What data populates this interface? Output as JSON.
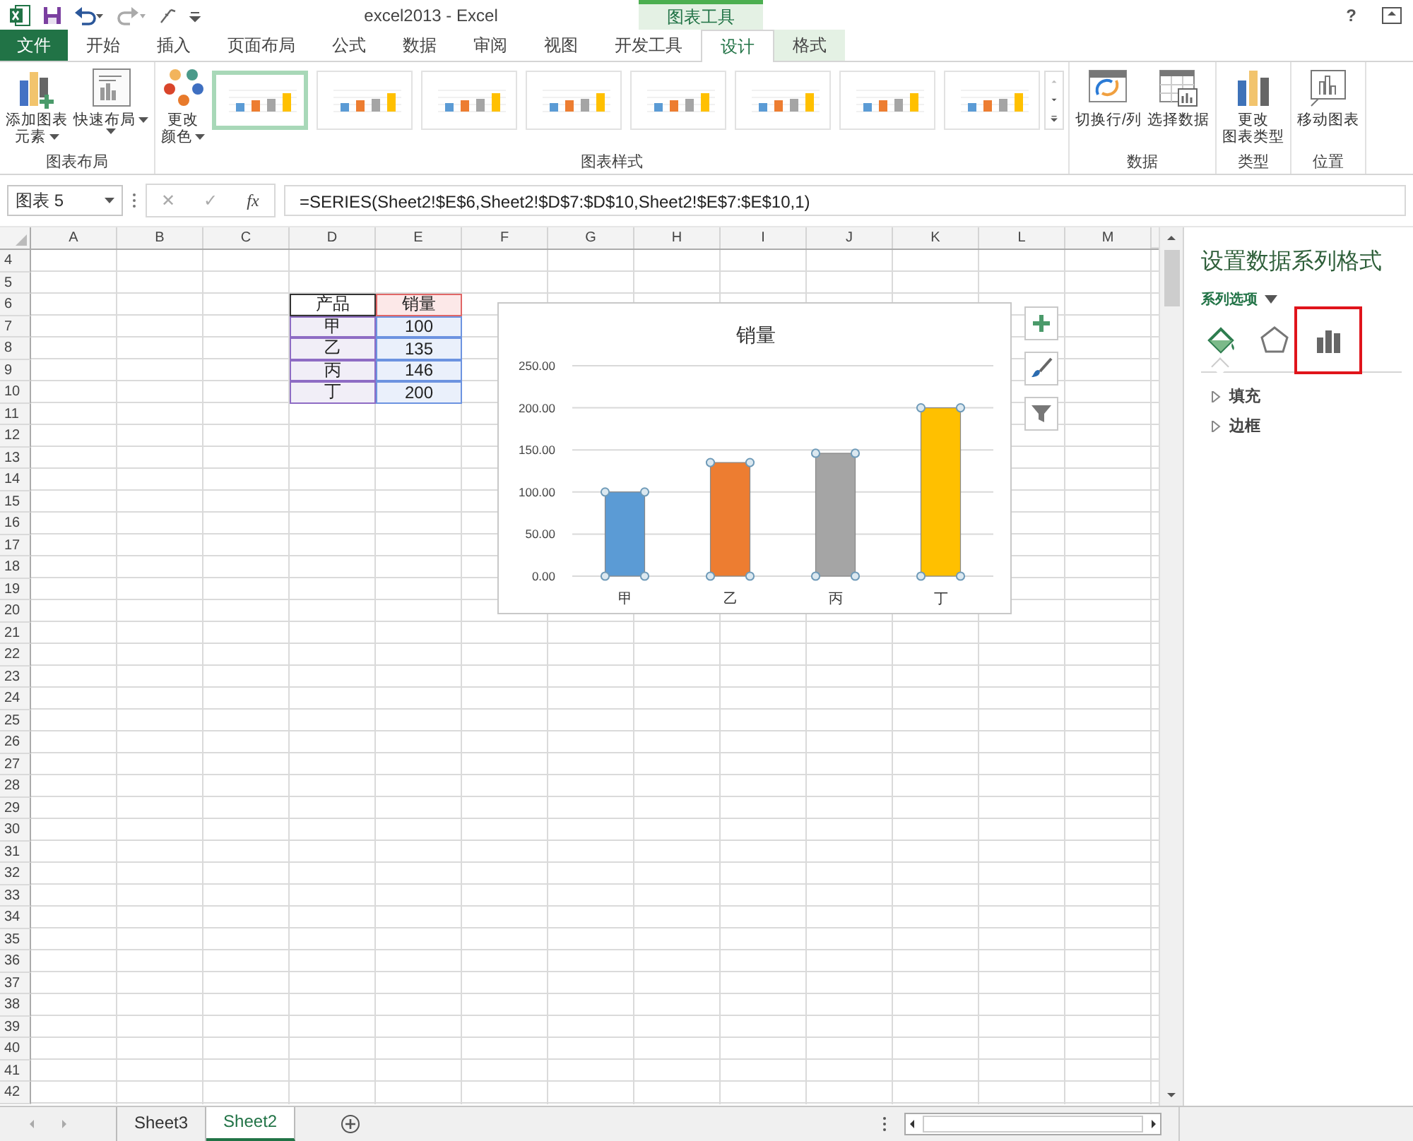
{
  "title_bar": {
    "title": "excel2013 - Excel",
    "context_label": "图表工具",
    "help": "?"
  },
  "tabs": [
    {
      "label": "文件",
      "kind": "file",
      "contextual": false,
      "selected": false
    },
    {
      "label": "开始",
      "kind": "tab",
      "contextual": false,
      "selected": false
    },
    {
      "label": "插入",
      "kind": "tab",
      "contextual": false,
      "selected": false
    },
    {
      "label": "页面布局",
      "kind": "tab",
      "contextual": false,
      "selected": false
    },
    {
      "label": "公式",
      "kind": "tab",
      "contextual": false,
      "selected": false
    },
    {
      "label": "数据",
      "kind": "tab",
      "contextual": false,
      "selected": false
    },
    {
      "label": "审阅",
      "kind": "tab",
      "contextual": false,
      "selected": false
    },
    {
      "label": "视图",
      "kind": "tab",
      "contextual": false,
      "selected": false
    },
    {
      "label": "开发工具",
      "kind": "tab",
      "contextual": false,
      "selected": false
    },
    {
      "label": "设计",
      "kind": "tab",
      "contextual": true,
      "selected": true
    },
    {
      "label": "格式",
      "kind": "tab",
      "contextual": true,
      "selected": false
    }
  ],
  "ribbon_groups": [
    {
      "label": "图表布局",
      "buttons": [
        {
          "kind": "add-element",
          "lines": [
            "添加图表",
            "元素"
          ],
          "dropdown": true
        },
        {
          "kind": "quick-layout",
          "lines": [
            "快速布局"
          ],
          "dropdown": true
        }
      ]
    },
    {
      "label": "图表样式",
      "buttons": [
        {
          "kind": "change-colors",
          "lines": [
            "更改",
            "颜色"
          ],
          "dropdown": true
        }
      ],
      "gallery": [
        {
          "selected": true
        },
        {
          "selected": false
        },
        {
          "selected": false
        },
        {
          "selected": false
        },
        {
          "selected": false
        },
        {
          "selected": false
        },
        {
          "selected": false
        },
        {
          "selected": false
        }
      ]
    },
    {
      "label": "数据",
      "buttons": [
        {
          "kind": "switch-row-col",
          "lines": [
            "切换行/列"
          ],
          "dropdown": false
        },
        {
          "kind": "select-data",
          "lines": [
            "选择数据"
          ],
          "dropdown": false
        }
      ]
    },
    {
      "label": "类型",
      "buttons": [
        {
          "kind": "change-type",
          "lines": [
            "更改",
            "图表类型"
          ],
          "dropdown": false
        }
      ]
    },
    {
      "label": "位置",
      "buttons": [
        {
          "kind": "move-chart",
          "lines": [
            "移动图表"
          ],
          "dropdown": false
        }
      ]
    }
  ],
  "formula_bar": {
    "name_box": "图表 5",
    "cancel": "✕",
    "enter": "✓",
    "function": "fx",
    "formula": "=SERIES(Sheet2!$E$6,Sheet2!$D$7:$D$10,Sheet2!$E$7:$E$10,1)"
  },
  "sheet": {
    "columns": [
      "A",
      "B",
      "C",
      "D",
      "E",
      "F",
      "G",
      "H",
      "I",
      "J",
      "K",
      "L",
      "M"
    ],
    "rows": [
      "4",
      "5",
      "6",
      "7",
      "8",
      "9",
      "10",
      "11",
      "12",
      "13",
      "14",
      "15",
      "16",
      "17",
      "18",
      "19",
      "20",
      "21",
      "22",
      "23",
      "24",
      "25",
      "26",
      "27",
      "28",
      "29",
      "30",
      "31",
      "32",
      "33",
      "34",
      "35",
      "36",
      "37",
      "38",
      "39",
      "40",
      "41",
      "42"
    ],
    "data_table": {
      "header": [
        "产品",
        "销量"
      ],
      "rows": [
        [
          "甲",
          "100"
        ],
        [
          "乙",
          "135"
        ],
        [
          "丙",
          "146"
        ],
        [
          "丁",
          "200"
        ]
      ]
    }
  },
  "chart": {
    "chart_data": {
      "type": "bar",
      "title": "销量",
      "categories": [
        "甲",
        "乙",
        "丙",
        "丁"
      ],
      "grid": true,
      "series": [
        {
          "color": "#5b9bd5",
          "values": [
            100,
            null,
            null,
            null
          ]
        },
        {
          "color": "#ed7d31",
          "values": [
            null,
            135,
            null,
            null
          ]
        },
        {
          "color": "#a5a5a5",
          "values": [
            null,
            null,
            146,
            null
          ]
        },
        {
          "color": "#ffc000",
          "values": [
            null,
            null,
            null,
            200
          ]
        }
      ],
      "ylim": [
        0,
        250
      ],
      "yticks": [
        {
          "value": 0,
          "label": "0.00"
        },
        {
          "value": 50,
          "label": "50.00"
        },
        {
          "value": 100,
          "label": "100.00"
        },
        {
          "value": 150,
          "label": "150.00"
        },
        {
          "value": 200,
          "label": "200.00"
        },
        {
          "value": 250,
          "label": "250.00"
        }
      ]
    }
  },
  "panel": {
    "title": "设置数据系列格式",
    "options_label": "系列选项",
    "icon_tabs": [
      {
        "kind": "fill",
        "selected": true,
        "highlighted": false
      },
      {
        "kind": "effects",
        "selected": false,
        "highlighted": false
      },
      {
        "kind": "series-options",
        "selected": false,
        "highlighted": true
      }
    ],
    "sections": [
      {
        "label": "填充",
        "expanded": false
      },
      {
        "label": "边框",
        "expanded": false
      }
    ]
  },
  "sheet_tabs": [
    {
      "label": "Sheet3",
      "selected": false
    },
    {
      "label": "Sheet2",
      "selected": true
    }
  ]
}
